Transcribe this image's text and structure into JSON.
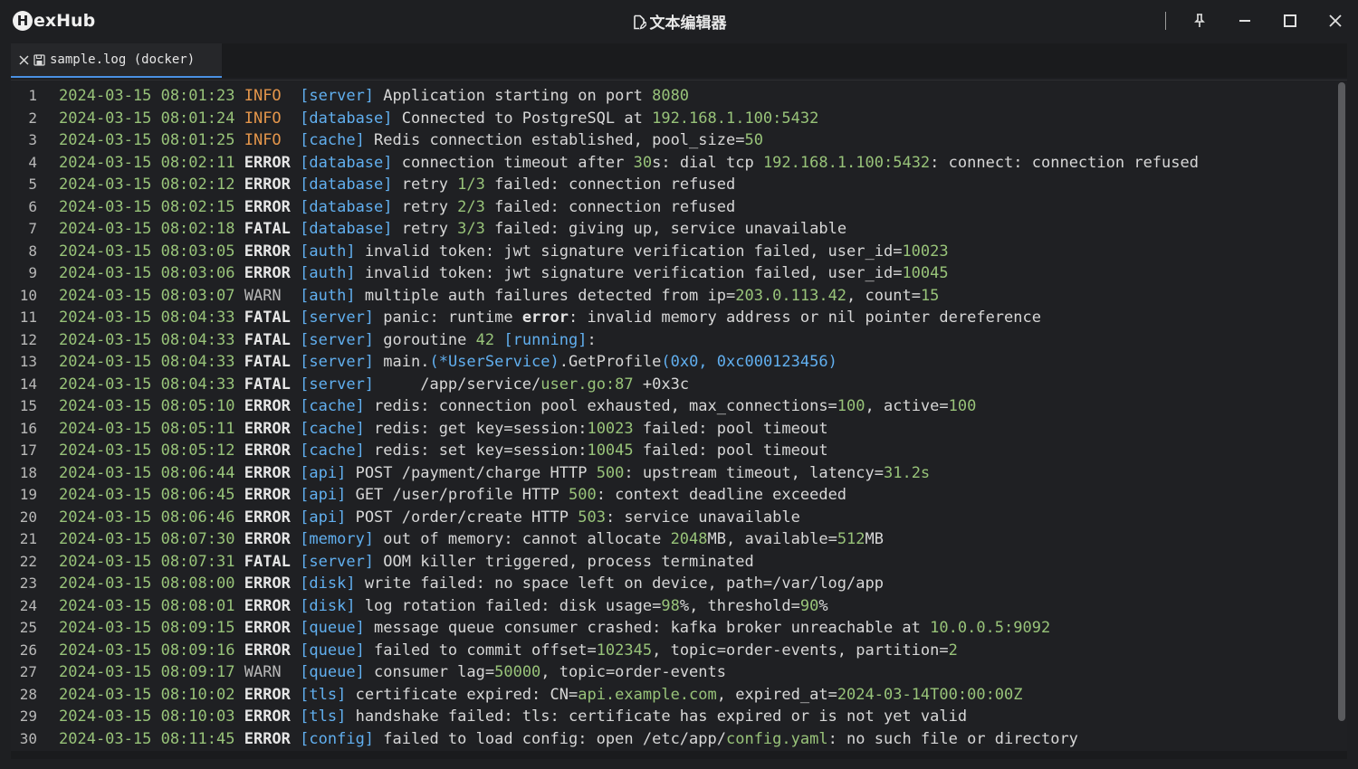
{
  "app": {
    "logo_letter": "H",
    "logo_text": "exHub",
    "window_title": "文本编辑器"
  },
  "tab": {
    "label": "sample.log (docker)"
  },
  "colors": {
    "timestamp": "#98c379",
    "info": "#e5964b",
    "tag": "#61afef",
    "number": "#98c379",
    "tab_accent": "#4a90e2",
    "background": "#1e1f22"
  },
  "lines": [
    {
      "n": "1",
      "ts": "2024-03-15 08:01:23",
      "level": "INFO",
      "tag": "[server]",
      "segs": [
        [
          "msg",
          " Application starting on port "
        ],
        [
          "num",
          "8080"
        ]
      ]
    },
    {
      "n": "2",
      "ts": "2024-03-15 08:01:24",
      "level": "INFO",
      "tag": "[database]",
      "segs": [
        [
          "msg",
          " Connected to PostgreSQL at "
        ],
        [
          "num",
          "192.168.1.100:5432"
        ]
      ]
    },
    {
      "n": "3",
      "ts": "2024-03-15 08:01:25",
      "level": "INFO",
      "tag": "[cache]",
      "segs": [
        [
          "msg",
          " Redis connection established, pool_size="
        ],
        [
          "num",
          "50"
        ]
      ]
    },
    {
      "n": "4",
      "ts": "2024-03-15 08:02:11",
      "level": "ERROR",
      "tag": "[database]",
      "segs": [
        [
          "msg",
          " connection timeout after "
        ],
        [
          "num",
          "30"
        ],
        [
          "msg",
          "s: dial tcp "
        ],
        [
          "num",
          "192.168.1.100:5432"
        ],
        [
          "msg",
          ": connect: connection refused"
        ]
      ]
    },
    {
      "n": "5",
      "ts": "2024-03-15 08:02:12",
      "level": "ERROR",
      "tag": "[database]",
      "segs": [
        [
          "msg",
          " retry "
        ],
        [
          "num",
          "1/3"
        ],
        [
          "msg",
          " failed: connection refused"
        ]
      ]
    },
    {
      "n": "6",
      "ts": "2024-03-15 08:02:15",
      "level": "ERROR",
      "tag": "[database]",
      "segs": [
        [
          "msg",
          " retry "
        ],
        [
          "num",
          "2/3"
        ],
        [
          "msg",
          " failed: connection refused"
        ]
      ]
    },
    {
      "n": "7",
      "ts": "2024-03-15 08:02:18",
      "level": "FATAL",
      "tag": "[database]",
      "segs": [
        [
          "msg",
          " retry "
        ],
        [
          "num",
          "3/3"
        ],
        [
          "msg",
          " failed: giving up, service unavailable"
        ]
      ]
    },
    {
      "n": "8",
      "ts": "2024-03-15 08:03:05",
      "level": "ERROR",
      "tag": "[auth]",
      "segs": [
        [
          "msg",
          " invalid token: jwt signature verification failed, user_id="
        ],
        [
          "num",
          "10023"
        ]
      ]
    },
    {
      "n": "9",
      "ts": "2024-03-15 08:03:06",
      "level": "ERROR",
      "tag": "[auth]",
      "segs": [
        [
          "msg",
          " invalid token: jwt signature verification failed, user_id="
        ],
        [
          "num",
          "10045"
        ]
      ]
    },
    {
      "n": "10",
      "ts": "2024-03-15 08:03:07",
      "level": "WARN",
      "tag": "[auth]",
      "segs": [
        [
          "msg",
          " multiple auth failures detected from ip="
        ],
        [
          "num",
          "203.0.113.42"
        ],
        [
          "msg",
          ", count="
        ],
        [
          "num",
          "15"
        ]
      ]
    },
    {
      "n": "11",
      "ts": "2024-03-15 08:04:33",
      "level": "FATAL",
      "tag": "[server]",
      "segs": [
        [
          "msg",
          " panic: runtime "
        ],
        [
          "kw",
          "error"
        ],
        [
          "msg",
          ": invalid memory address or nil pointer dereference"
        ]
      ]
    },
    {
      "n": "12",
      "ts": "2024-03-15 08:04:33",
      "level": "FATAL",
      "tag": "[server]",
      "segs": [
        [
          "msg",
          " goroutine "
        ],
        [
          "num",
          "42"
        ],
        [
          "msg",
          " "
        ],
        [
          "blue",
          "[running]"
        ],
        [
          "msg",
          ":"
        ]
      ]
    },
    {
      "n": "13",
      "ts": "2024-03-15 08:04:33",
      "level": "FATAL",
      "tag": "[server]",
      "segs": [
        [
          "msg",
          " main."
        ],
        [
          "blue",
          "(*UserService)"
        ],
        [
          "msg",
          ".GetProfile"
        ],
        [
          "blue",
          "(0x0, 0xc000123456)"
        ]
      ]
    },
    {
      "n": "14",
      "ts": "2024-03-15 08:04:33",
      "level": "FATAL",
      "tag": "[server]",
      "segs": [
        [
          "msg",
          "     /app/service/"
        ],
        [
          "green",
          "user.go:87"
        ],
        [
          "msg",
          " +0x3c"
        ]
      ]
    },
    {
      "n": "15",
      "ts": "2024-03-15 08:05:10",
      "level": "ERROR",
      "tag": "[cache]",
      "segs": [
        [
          "msg",
          " redis: connection pool exhausted, max_connections="
        ],
        [
          "num",
          "100"
        ],
        [
          "msg",
          ", active="
        ],
        [
          "num",
          "100"
        ]
      ]
    },
    {
      "n": "16",
      "ts": "2024-03-15 08:05:11",
      "level": "ERROR",
      "tag": "[cache]",
      "segs": [
        [
          "msg",
          " redis: get key=session:"
        ],
        [
          "num",
          "10023"
        ],
        [
          "msg",
          " failed: pool timeout"
        ]
      ]
    },
    {
      "n": "17",
      "ts": "2024-03-15 08:05:12",
      "level": "ERROR",
      "tag": "[cache]",
      "segs": [
        [
          "msg",
          " redis: set key=session:"
        ],
        [
          "num",
          "10045"
        ],
        [
          "msg",
          " failed: pool timeout"
        ]
      ]
    },
    {
      "n": "18",
      "ts": "2024-03-15 08:06:44",
      "level": "ERROR",
      "tag": "[api]",
      "segs": [
        [
          "msg",
          " POST /payment/charge HTTP "
        ],
        [
          "num",
          "500"
        ],
        [
          "msg",
          ": upstream timeout, latency="
        ],
        [
          "num",
          "31.2s"
        ]
      ]
    },
    {
      "n": "19",
      "ts": "2024-03-15 08:06:45",
      "level": "ERROR",
      "tag": "[api]",
      "segs": [
        [
          "msg",
          " GET /user/profile HTTP "
        ],
        [
          "num",
          "500"
        ],
        [
          "msg",
          ": context deadline exceeded"
        ]
      ]
    },
    {
      "n": "20",
      "ts": "2024-03-15 08:06:46",
      "level": "ERROR",
      "tag": "[api]",
      "segs": [
        [
          "msg",
          " POST /order/create HTTP "
        ],
        [
          "num",
          "503"
        ],
        [
          "msg",
          ": service unavailable"
        ]
      ]
    },
    {
      "n": "21",
      "ts": "2024-03-15 08:07:30",
      "level": "ERROR",
      "tag": "[memory]",
      "segs": [
        [
          "msg",
          " out of memory: cannot allocate "
        ],
        [
          "num",
          "2048"
        ],
        [
          "msg",
          "MB, available="
        ],
        [
          "num",
          "512"
        ],
        [
          "msg",
          "MB"
        ]
      ]
    },
    {
      "n": "22",
      "ts": "2024-03-15 08:07:31",
      "level": "FATAL",
      "tag": "[server]",
      "segs": [
        [
          "msg",
          " OOM killer triggered, process terminated"
        ]
      ]
    },
    {
      "n": "23",
      "ts": "2024-03-15 08:08:00",
      "level": "ERROR",
      "tag": "[disk]",
      "segs": [
        [
          "msg",
          " write failed: no space left on device, path=/var/log/app"
        ]
      ]
    },
    {
      "n": "24",
      "ts": "2024-03-15 08:08:01",
      "level": "ERROR",
      "tag": "[disk]",
      "segs": [
        [
          "msg",
          " log rotation failed: disk usage="
        ],
        [
          "num",
          "98"
        ],
        [
          "msg",
          "%, threshold="
        ],
        [
          "num",
          "90"
        ],
        [
          "msg",
          "%"
        ]
      ]
    },
    {
      "n": "25",
      "ts": "2024-03-15 08:09:15",
      "level": "ERROR",
      "tag": "[queue]",
      "segs": [
        [
          "msg",
          " message queue consumer crashed: kafka broker unreachable at "
        ],
        [
          "num",
          "10.0.0.5:9092"
        ]
      ]
    },
    {
      "n": "26",
      "ts": "2024-03-15 08:09:16",
      "level": "ERROR",
      "tag": "[queue]",
      "segs": [
        [
          "msg",
          " failed to commit offset="
        ],
        [
          "num",
          "102345"
        ],
        [
          "msg",
          ", topic=order-events, partition="
        ],
        [
          "num",
          "2"
        ]
      ]
    },
    {
      "n": "27",
      "ts": "2024-03-15 08:09:17",
      "level": "WARN",
      "tag": "[queue]",
      "segs": [
        [
          "msg",
          " consumer lag="
        ],
        [
          "num",
          "50000"
        ],
        [
          "msg",
          ", topic=order-events"
        ]
      ]
    },
    {
      "n": "28",
      "ts": "2024-03-15 08:10:02",
      "level": "ERROR",
      "tag": "[tls]",
      "segs": [
        [
          "msg",
          " certificate expired: CN="
        ],
        [
          "green",
          "api.example.com"
        ],
        [
          "msg",
          ", expired_at="
        ],
        [
          "num",
          "2024-03-14T00:00:00Z"
        ]
      ]
    },
    {
      "n": "29",
      "ts": "2024-03-15 08:10:03",
      "level": "ERROR",
      "tag": "[tls]",
      "segs": [
        [
          "msg",
          " handshake failed: tls: certificate has expired or is not yet valid"
        ]
      ]
    },
    {
      "n": "30",
      "ts": "2024-03-15 08:11:45",
      "level": "ERROR",
      "tag": "[config]",
      "segs": [
        [
          "msg",
          " failed to load config: open /etc/app/"
        ],
        [
          "green",
          "config.yaml"
        ],
        [
          "msg",
          ": no such file or directory"
        ]
      ]
    }
  ]
}
